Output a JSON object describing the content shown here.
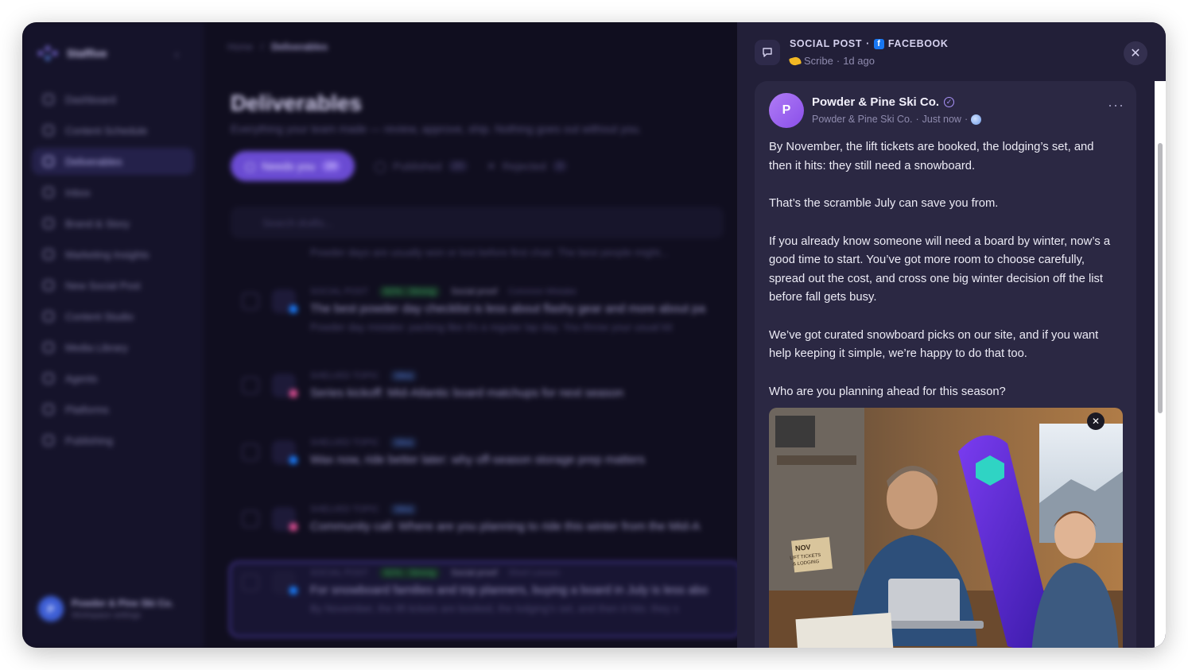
{
  "background_app": {
    "brand": "Staffive",
    "nav": [
      "Dashboard",
      "Content Schedule",
      "Deliverables",
      "Inbox",
      "Brand & Story",
      "Marketing Insights",
      "New Social Post",
      "Content Studio",
      "Media Library",
      "Agents",
      "Platforms",
      "Publishing"
    ],
    "active_nav": "Deliverables",
    "breadcrumb": [
      "Home",
      "Deliverables"
    ],
    "title": "Deliverables",
    "subtitle": "Everything your team made — review, approve, ship. Nothing goes out without you.",
    "filters": {
      "needs_you": {
        "label": "Needs you",
        "count": "24"
      },
      "published": {
        "label": "Published",
        "count": "20"
      },
      "rejected": {
        "label": "Rejected",
        "count": "3"
      }
    },
    "search_placeholder": "Search drafts...",
    "partial_row_text": "Powder days are usually won or lost before first chair. The best people might...",
    "rows": [
      {
        "type": "SOCIAL POST",
        "score": "92% · Strong",
        "tag": "Social proof",
        "tag2": "Common Mistake",
        "title": "The best powder day checklist is less about flashy gear and more about pa",
        "snippet": "Powder day mistake: packing like it's a regular lap day. You throw your usual kit",
        "platform": "facebook"
      },
      {
        "type": "SHELVED TOPIC",
        "badge": "Idea",
        "title": "Series kickoff: Mid-Atlantic board matchups for next season",
        "platform": "instagram"
      },
      {
        "type": "SHELVED TOPIC",
        "badge": "Idea",
        "title": "Wax now, ride better later: why off-season storage prep matters",
        "platform": "facebook"
      },
      {
        "type": "SHELVED TOPIC",
        "badge": "Idea",
        "title": "Community call: Where are you planning to ride this winter from the Mid-A",
        "platform": "instagram"
      },
      {
        "type": "SOCIAL POST",
        "score": "92% · Strong",
        "tag": "Social proof",
        "tag2": "Short Lesson",
        "title": "For snowboard families and trip planners, buying a board in July is less abo",
        "snippet": "By November, the lift tickets are booked, the lodging's set, and then it hits: they s",
        "platform": "facebook"
      }
    ],
    "account": {
      "initial": "P",
      "name": "Powder & Pine Ski Co.",
      "sub": "Workspace settings"
    }
  },
  "panel": {
    "kind": "SOCIAL POST",
    "platform": "FACEBOOK",
    "author": "Scribe",
    "age": "1d ago",
    "page": {
      "initial": "P",
      "name": "Powder & Pine Ski Co.",
      "handle": "Powder & Pine Ski Co.",
      "time": "Just now"
    },
    "paragraphs": [
      "By November, the lift tickets are booked, the lodging’s set, and then it hits: they still need a snowboard.",
      "That’s the scramble July can save you from.",
      "If you already know someone will need a board by winter, now’s a good time to start. You’ve got more room to choose carefully, spread out the cost, and cross one big winter decision off the list before fall gets busy.",
      "We’ve got curated snowboard picks on our site, and if you want help keeping it simple, we’re happy to do that too.",
      "Who are you planning ahead for this season?"
    ],
    "image_sign": [
      "NOV",
      "LIFT TICKETS",
      "& LODGING"
    ]
  },
  "colors": {
    "accent": "#6a4bd2",
    "facebook": "#1877f2",
    "panel_bg": "#221f38",
    "card_bg": "#2b2843"
  },
  "icons": {
    "close": "close-icon",
    "post": "chat-bubble-icon",
    "more": "more-horizontal-icon",
    "verified": "verified-badge-icon",
    "globe": "globe-icon"
  }
}
